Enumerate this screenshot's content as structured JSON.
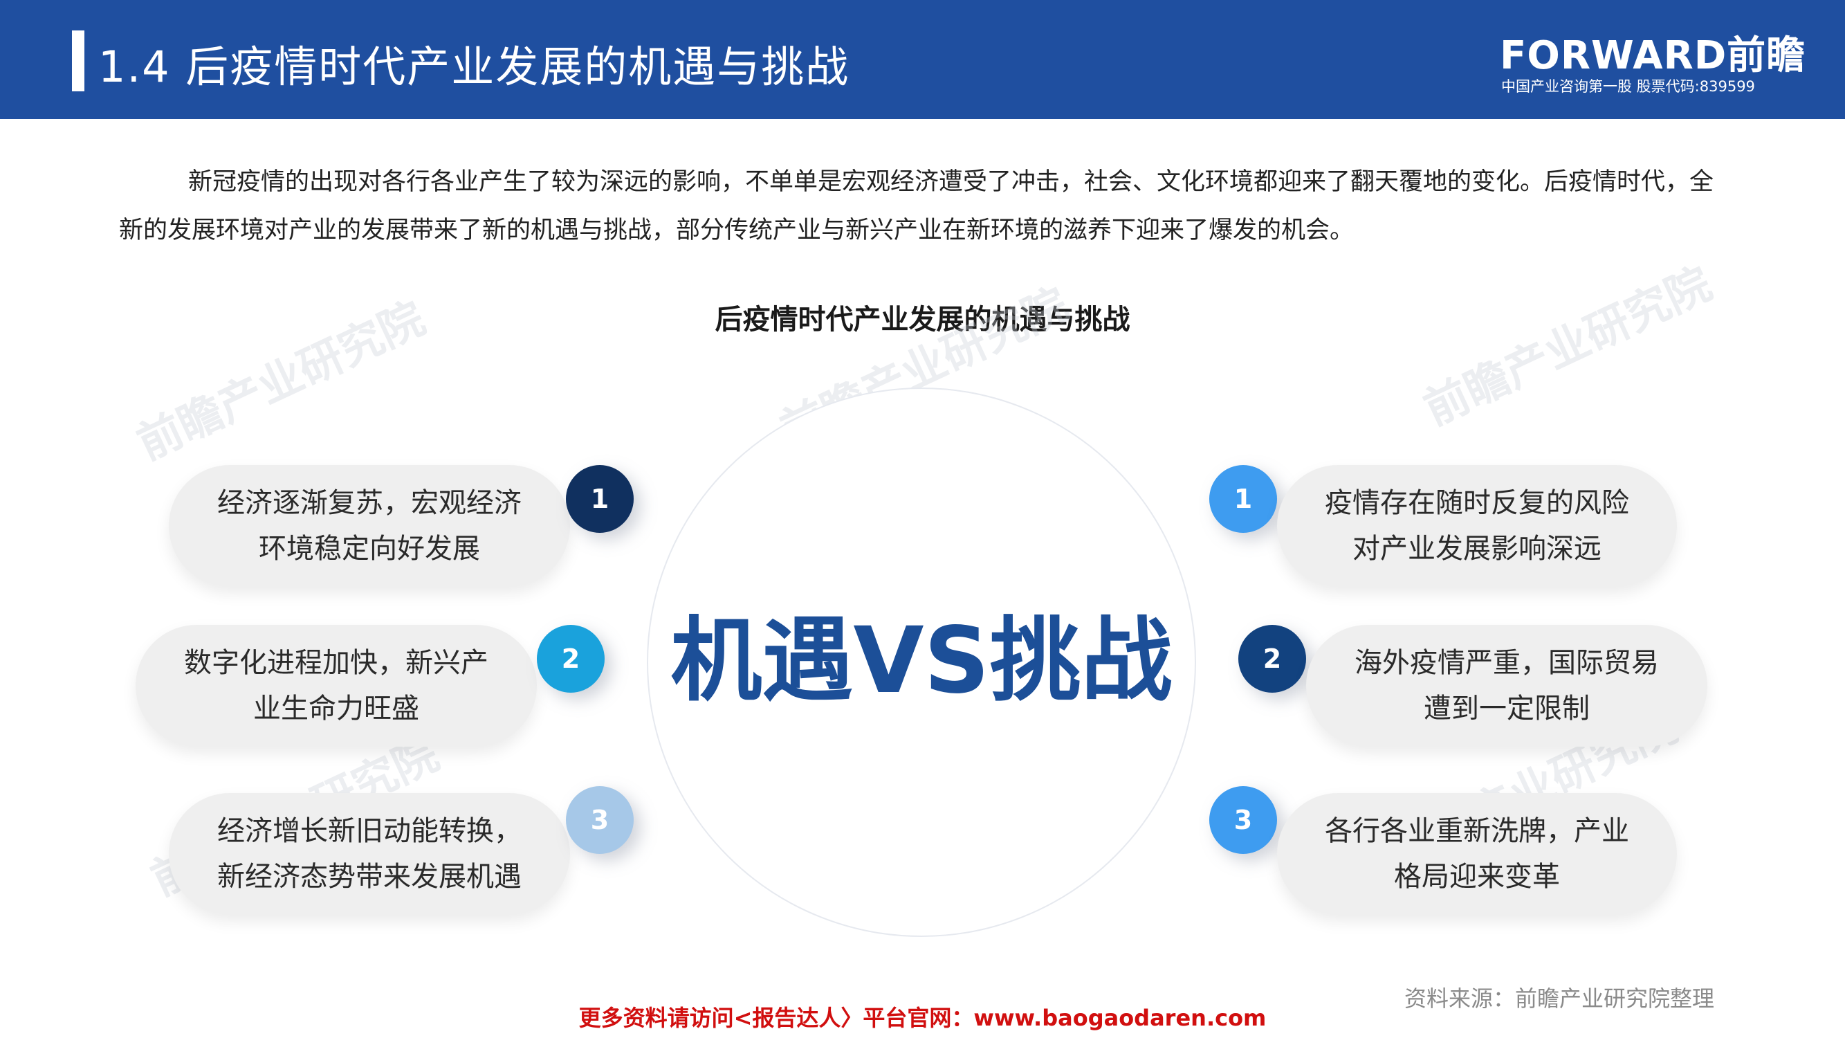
{
  "header": {
    "title": "1.4 后疫情时代产业发展的机遇与挑战",
    "logo": "FORWARD前瞻",
    "logo_sub": "中国产业咨询第一股  股票代码:839599"
  },
  "intro": "新冠疫情的出现对各行各业产生了较为深远的影响，不单单是宏观经济遭受了冲击，社会、文化环境都迎来了翻天覆地的变化。后疫情时代，全新的发展环境对产业的发展带来了新的机遇与挑战，部分传统产业与新兴产业在新环境的滋养下迎来了爆发的机会。",
  "diagram": {
    "title": "后疫情时代产业发展的机遇与挑战",
    "center": "机遇VS挑战",
    "opportunities": [
      {
        "num": "1",
        "line1": "经济逐渐复苏，宏观经济",
        "line2": "环境稳定向好发展",
        "color": "#10305f"
      },
      {
        "num": "2",
        "line1": "数字化进程加快，新兴产",
        "line2": "业生命力旺盛",
        "color": "#1aa2dc"
      },
      {
        "num": "3",
        "line1": "经济增长新旧动能转换，",
        "line2": "新经济态势带来发展机遇",
        "color": "#a6c8e8"
      }
    ],
    "challenges": [
      {
        "num": "1",
        "line1": "疫情存在随时反复的风险",
        "line2": "对产业发展影响深远",
        "color": "#3e9cf0"
      },
      {
        "num": "2",
        "line1": "海外疫情严重，国际贸易",
        "line2": "遭到一定限制",
        "color": "#12427f"
      },
      {
        "num": "3",
        "line1": "各行各业重新洗牌，产业",
        "line2": "格局迎来变革",
        "color": "#3e9cf0"
      }
    ]
  },
  "footer": {
    "source": "资料来源：前瞻产业研究院整理",
    "promo": "更多资料请访问<报告达人〉平台官网：www.baogaodaren.com"
  },
  "watermark": {
    "text": "前瞻产业研究院"
  },
  "colors": {
    "header_bg": "#1f4fa0",
    "center_text": "#1c4f98",
    "promo": "#d10f0f"
  }
}
